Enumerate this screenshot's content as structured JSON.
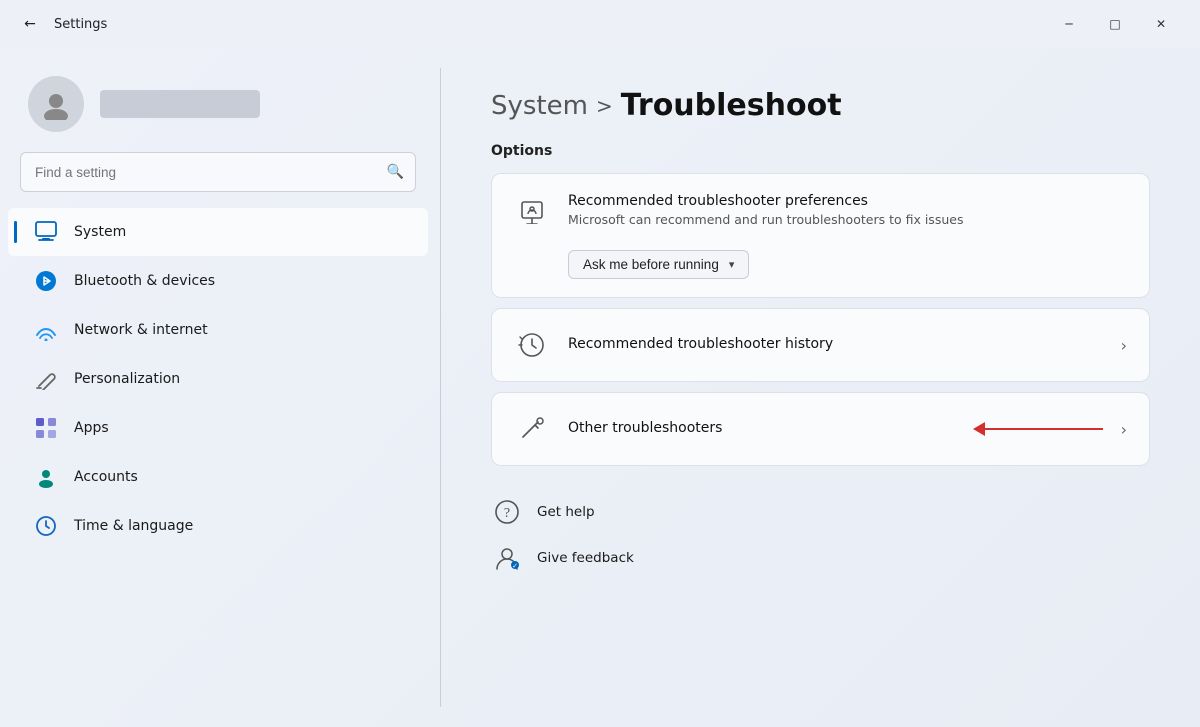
{
  "titlebar": {
    "title": "Settings",
    "back_label": "←",
    "minimize_label": "─",
    "maximize_label": "□",
    "close_label": "✕"
  },
  "sidebar": {
    "search_placeholder": "Find a setting",
    "nav_items": [
      {
        "id": "system",
        "label": "System",
        "icon": "🖥",
        "active": true
      },
      {
        "id": "bluetooth",
        "label": "Bluetooth & devices",
        "icon": "🔵",
        "active": false
      },
      {
        "id": "network",
        "label": "Network & internet",
        "icon": "💠",
        "active": false
      },
      {
        "id": "personalization",
        "label": "Personalization",
        "icon": "✏️",
        "active": false
      },
      {
        "id": "apps",
        "label": "Apps",
        "icon": "🟦",
        "active": false
      },
      {
        "id": "accounts",
        "label": "Accounts",
        "icon": "🟢",
        "active": false
      },
      {
        "id": "time",
        "label": "Time & language",
        "icon": "🔵",
        "active": false
      }
    ]
  },
  "content": {
    "breadcrumb_parent": "System",
    "breadcrumb_separator": ">",
    "breadcrumb_current": "Troubleshoot",
    "section_title": "Options",
    "cards": [
      {
        "id": "recommended-prefs",
        "title": "Recommended troubleshooter preferences",
        "subtitle": "Microsoft can recommend and run troubleshooters to fix issues",
        "has_dropdown": true,
        "dropdown_label": "Ask me before running",
        "has_chevron": false
      },
      {
        "id": "recommended-history",
        "title": "Recommended troubleshooter history",
        "subtitle": "",
        "has_dropdown": false,
        "has_chevron": true
      },
      {
        "id": "other-troubleshooters",
        "title": "Other troubleshooters",
        "subtitle": "",
        "has_dropdown": false,
        "has_chevron": true,
        "has_arrow": true
      }
    ],
    "bottom_links": [
      {
        "id": "get-help",
        "label": "Get help",
        "icon": "❓"
      },
      {
        "id": "give-feedback",
        "label": "Give feedback",
        "icon": "👤"
      }
    ]
  }
}
